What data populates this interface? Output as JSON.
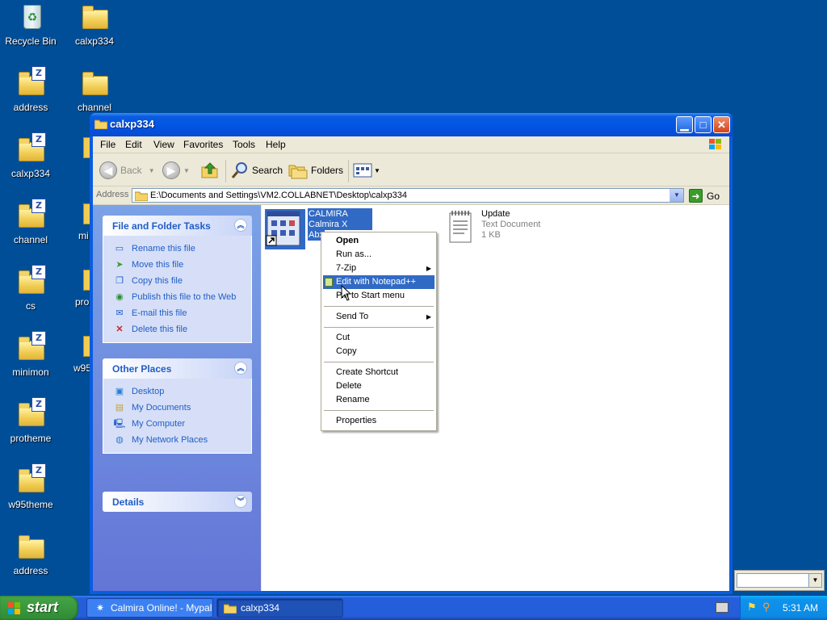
{
  "desktop": {
    "icons": [
      {
        "label": "Recycle Bin",
        "icon": "recycle-bin-icon"
      },
      {
        "label": "calxp334",
        "icon": "folder-icon"
      },
      {
        "label": "address",
        "icon": "zip-folder-icon"
      },
      {
        "label": "channel",
        "icon": "folder-icon"
      },
      {
        "label": "calxp334",
        "icon": "zip-folder-icon"
      },
      {
        "label": "channel",
        "icon": "zip-folder-icon"
      },
      {
        "label": "cs",
        "icon": "zip-folder-icon"
      },
      {
        "label": "minimon",
        "icon": "zip-folder-icon"
      },
      {
        "label": "protheme",
        "icon": "zip-folder-icon"
      },
      {
        "label": "w95theme",
        "icon": "zip-folder-icon"
      },
      {
        "label": "address",
        "icon": "folder-icon"
      }
    ],
    "partial_labels": [
      "mi",
      "pro",
      "w95"
    ]
  },
  "window": {
    "title": "calxp334",
    "menu": [
      "File",
      "Edit",
      "View",
      "Favorites",
      "Tools",
      "Help"
    ],
    "toolbar": {
      "back": "Back",
      "search": "Search",
      "folders": "Folders"
    },
    "address": {
      "label": "Address",
      "path": "E:\\Documents and Settings\\VM2.COLLABNET\\Desktop\\calxp334",
      "go": "Go"
    },
    "taskpane": {
      "file_tasks": {
        "title": "File and Folder Tasks",
        "links": [
          "Rename this file",
          "Move this file",
          "Copy this file",
          "Publish this file to the Web",
          "E-mail this file",
          "Delete this file"
        ]
      },
      "other_places": {
        "title": "Other Places",
        "links": [
          "Desktop",
          "My Documents",
          "My Computer",
          "My Network Places"
        ]
      },
      "details": {
        "title": "Details"
      }
    },
    "files": [
      {
        "name": "CALMIRA",
        "type": "Calmira X",
        "extra": "Abx",
        "selected": true
      },
      {
        "name": "Update",
        "type": "Text Document",
        "size": "1 KB",
        "selected": false
      }
    ]
  },
  "context_menu": {
    "items": [
      "Open",
      "Run as...",
      "7-Zip",
      "Edit with Notepad++",
      "Pin to Start menu",
      "Send To",
      "Cut",
      "Copy",
      "Create Shortcut",
      "Delete",
      "Rename",
      "Properties"
    ],
    "highlighted": "Edit with Notepad++"
  },
  "taskbar": {
    "start": "start",
    "tasks": [
      "Calmira Online! - Mypal",
      "calxp334"
    ],
    "active_task": "calxp334",
    "clock": "5:31 AM"
  },
  "colors": {
    "desktop": "#004e98",
    "selection": "#316ac5",
    "taskpane_link": "#215dc6"
  }
}
